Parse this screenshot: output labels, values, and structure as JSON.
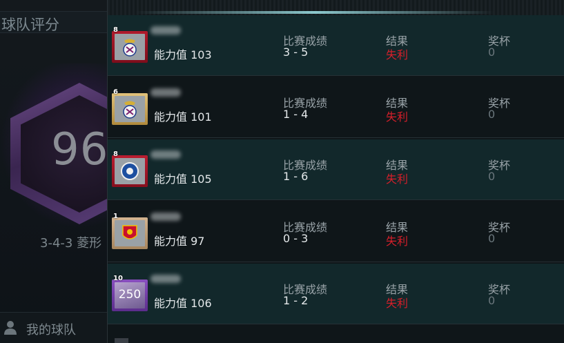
{
  "left_panel": {
    "title": "球队评分",
    "score": "96",
    "formation": "3-4-3 菱形",
    "bottom_label": "我的球队"
  },
  "columns": {
    "result_label": "比赛成绩",
    "outcome_label": "结果",
    "trophy_label": "奖杯"
  },
  "matches": [
    {
      "badge_level": "8",
      "badge_icon": "real-madrid-crest-icon",
      "ability": "能力值 103",
      "score": "3 - 5",
      "outcome": "失利",
      "trophy": "0"
    },
    {
      "badge_level": "6",
      "badge_icon": "real-madrid-crest-icon",
      "ability": "能力值 101",
      "score": "1 - 4",
      "outcome": "失利",
      "trophy": "0"
    },
    {
      "badge_level": "8",
      "badge_icon": "leicester-crest-icon",
      "ability": "能力值 105",
      "score": "1 - 6",
      "outcome": "失利",
      "trophy": "0"
    },
    {
      "badge_level": "1",
      "badge_icon": "manchester-united-crest-icon",
      "ability": "能力值 97",
      "score": "0 - 3",
      "outcome": "失利",
      "trophy": "0"
    },
    {
      "badge_level": "10",
      "badge_text": "250",
      "ability": "能力值 106",
      "score": "1 - 2",
      "outcome": "失利",
      "trophy": "0"
    }
  ],
  "colors": {
    "loss": "#d61f2a",
    "row_teal": "#12282b",
    "row_dark": "#0f1619",
    "accent_glow": "#a0e6eb"
  }
}
